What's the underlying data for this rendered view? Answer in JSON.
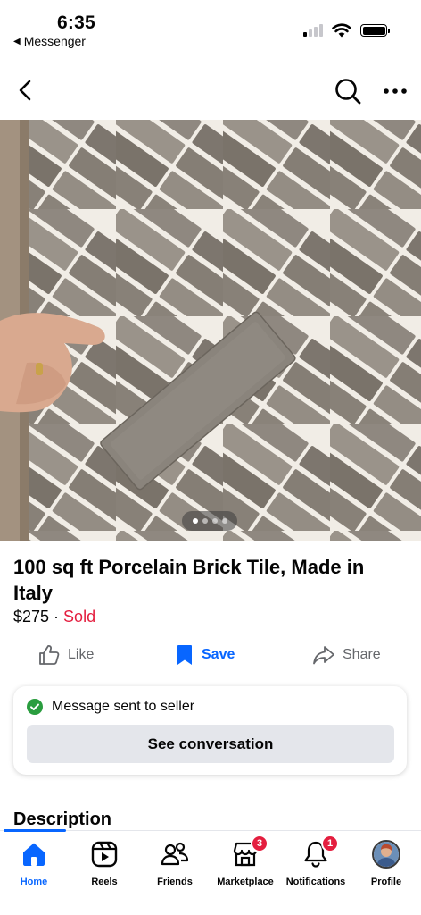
{
  "status_bar": {
    "time": "6:35",
    "back_app_label": "Messenger",
    "signal_bars_active": 1,
    "battery_level": 1.0
  },
  "nav": {
    "back_icon": "chevron-left-icon",
    "search_icon": "search-icon",
    "more_icon": "more-horizontal-icon"
  },
  "gallery": {
    "photo_count": 4,
    "active_index": 0
  },
  "listing": {
    "title": "100 sq ft Porcelain Brick Tile, Made in Italy",
    "price": "$275",
    "separator": " · ",
    "status": "Sold"
  },
  "actions": {
    "like_label": "Like",
    "save_label": "Save",
    "share_label": "Share"
  },
  "message_card": {
    "status_text": "Message sent to seller",
    "button_label": "See conversation"
  },
  "section": {
    "description_heading": "Description"
  },
  "tabs": [
    {
      "label": "Home",
      "icon": "home-icon",
      "active": true
    },
    {
      "label": "Reels",
      "icon": "reels-icon",
      "active": false
    },
    {
      "label": "Friends",
      "icon": "friends-icon",
      "active": false
    },
    {
      "label": "Marketplace",
      "icon": "marketplace-icon",
      "badge": "3",
      "active": false
    },
    {
      "label": "Notifications",
      "icon": "bell-icon",
      "badge": "1",
      "active": false
    },
    {
      "label": "Profile",
      "icon": "avatar",
      "active": false
    }
  ],
  "colors": {
    "accent": "#0866ff",
    "sold": "#e41e3f",
    "success": "#2a9d3f",
    "badge": "#e41e3f"
  }
}
